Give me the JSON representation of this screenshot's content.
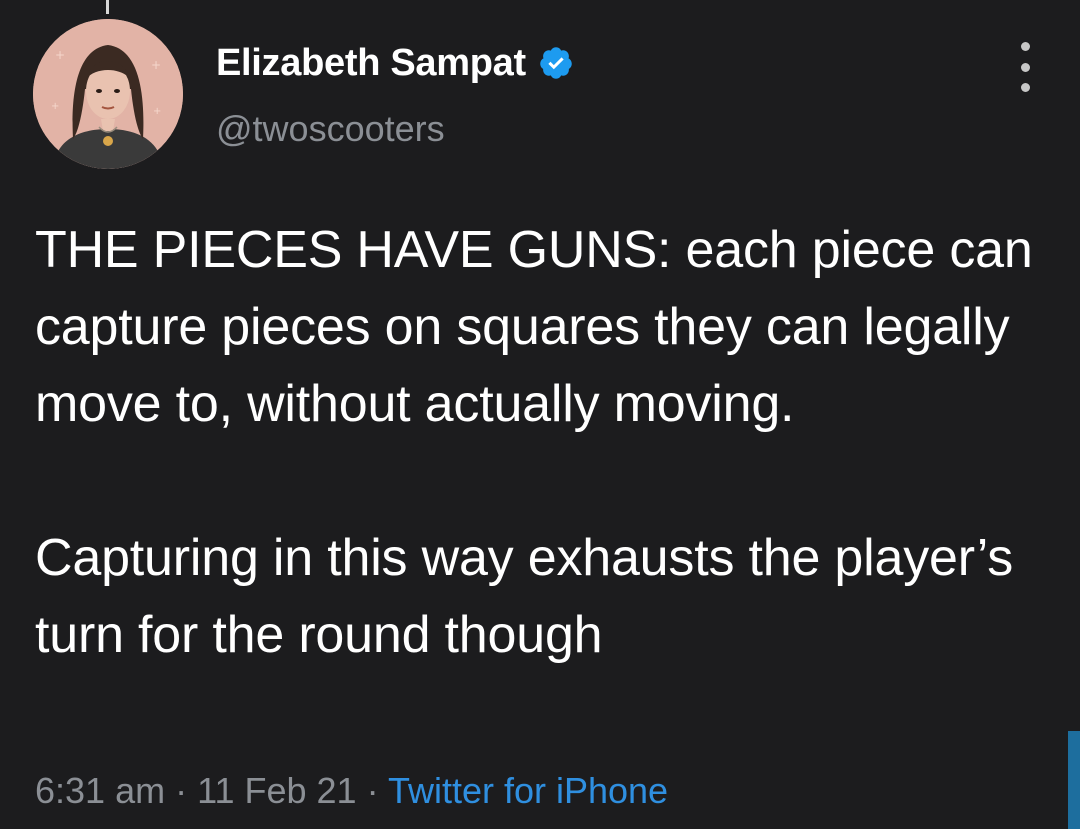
{
  "tweet": {
    "author": {
      "display_name": "Elizabeth Sampat",
      "handle": "@twoscooters",
      "verified": true,
      "avatar_icon": "avatar-illustration"
    },
    "paragraphs": [
      "THE PIECES HAVE GUNS: each piece can capture pieces on squares they can legally move to, without actually moving.",
      "Capturing in this way exhausts the player’s turn for the round though"
    ],
    "time": "6:31 am",
    "date": "11 Feb 21",
    "separator": "·",
    "source": "Twitter for iPhone"
  },
  "icons": {
    "verified": "verified-badge-icon",
    "menu": "more-options-icon"
  },
  "colors": {
    "background": "#1c1c1e",
    "text_primary": "#ffffff",
    "text_secondary": "#8b8f95",
    "link": "#2f8fe0",
    "verified": "#1d9bf0"
  }
}
